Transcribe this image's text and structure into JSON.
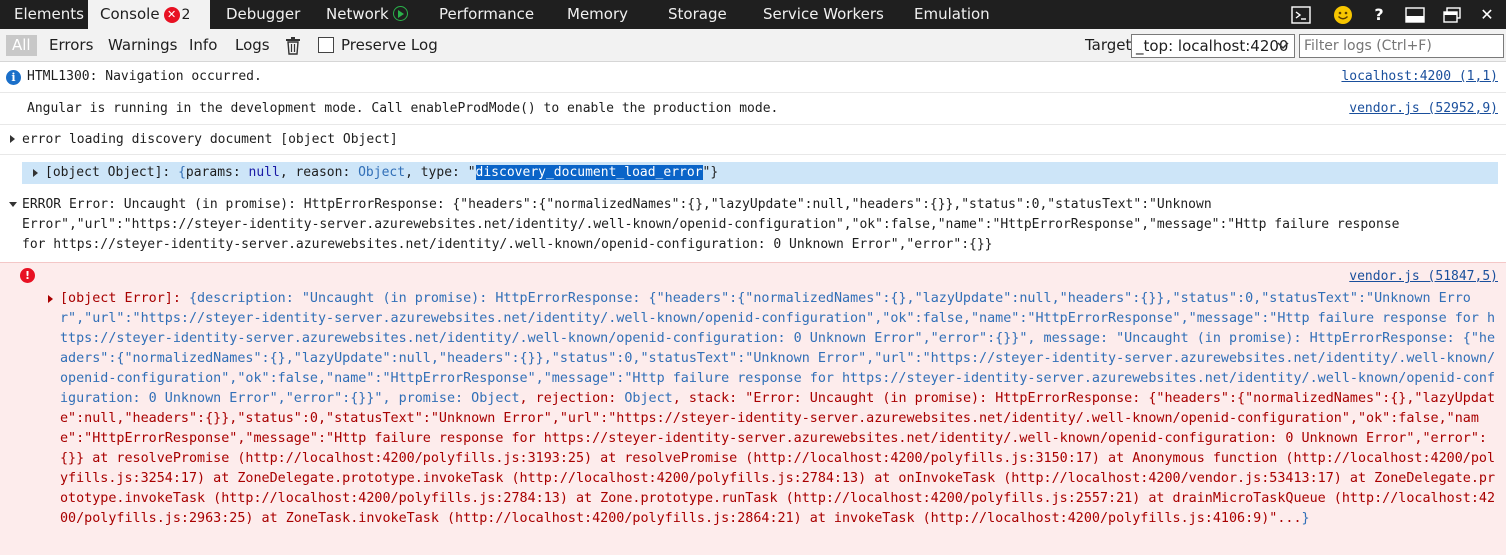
{
  "tabs": {
    "elements": "Elements",
    "console": "Console",
    "console_error_count": "2",
    "debugger": "Debugger",
    "network": "Network",
    "performance": "Performance",
    "memory": "Memory",
    "storage": "Storage",
    "service_workers": "Service Workers",
    "emulation": "Emulation"
  },
  "toolbar": {
    "all": "All",
    "errors": "Errors",
    "warnings": "Warnings",
    "info": "Info",
    "logs": "Logs",
    "preserve_log": "Preserve Log",
    "target_label": "Target",
    "target_value": "_top: localhost:4200",
    "filter_placeholder": "Filter logs (Ctrl+F)"
  },
  "console": {
    "line1": {
      "text": "HTML1300: Navigation occurred.",
      "source": "localhost:4200 (1,1)"
    },
    "line2": {
      "text": "Angular is running in the development mode. Call enableProdMode() to enable the production mode.",
      "source": "vendor.js (52952,9)"
    },
    "line3": {
      "text": "error loading discovery document [object Object]"
    },
    "line4": {
      "p1": "[object Object]: ",
      "p2": "{",
      "p3": "params: ",
      "p4": "null",
      "p5": ", reason: ",
      "p6": "Object",
      "p7": ", type: \"",
      "p8": "discovery_document_load_error",
      "p9": "\"}"
    },
    "line5": {
      "row1": "ERROR Error: Uncaught (in promise): HttpErrorResponse: {\"headers\":{\"normalizedNames\":{},\"lazyUpdate\":null,\"headers\":{}},\"status\":0,\"statusText\":\"Unknown",
      "row2": "Error\",\"url\":\"https://steyer-identity-server.azurewebsites.net/identity/.well-known/openid-configuration\",\"ok\":false,\"name\":\"HttpErrorResponse\",\"message\":\"Http failure response",
      "row3": "for https://steyer-identity-server.azurewebsites.net/identity/.well-known/openid-configuration: 0 Unknown Error\",\"error\":{}}"
    },
    "error_block": {
      "source": "vendor.js (51847,5)",
      "head": "[object Error]: ",
      "t1": "{description: \"Uncaught (in promise): HttpErrorResponse: {\"headers\":{\"normalizedNames\":{},\"lazyUpdate\":null,\"headers\":{}},\"status\":0,\"statusText\":\"Unknown Error\",\"url\":\"https://steyer-identity-server.azurewebsites.net/identity/.well-known/openid-configuration\",\"ok\":false,\"name\":\"HttpErrorResponse\",\"message\":\"Http failure response for https://steyer-identity-server.azurewebsites.net/identity/.well-known/openid-configuration: 0 Unknown Error\",\"error\":{}}\", message: \"Uncaught (in promise): HttpErrorResponse: {\"headers\":{\"normalizedNames\":{},\"lazyUpdate\":null,\"headers\":{}},\"status\":0,\"statusText\":\"Unknown Error\",\"url\":\"https://steyer-identity-server.azurewebsites.net/identity/.well-known/openid-configuration\",\"ok\":false,\"name\":\"HttpErrorResponse\",\"message\":\"Http failure response for https://steyer-identity-server.azurewebsites.net/identity/.well-known/openid-configuration: 0 Unknown Error\",\"error\":{}}\", promise: ",
      "o1": "Object",
      "t2": ", rejection: ",
      "o2": "Object",
      "t3": ", stack: \"Error: Uncaught (in promise): HttpErrorResponse: {\"headers\":{\"normalizedNames\":{},\"lazyUpdate\":null,\"headers\":{}},\"status\":0,\"statusText\":\"Unknown Error\",\"url\":\"https://steyer-identity-server.azurewebsites.net/identity/.well-known/openid-configuration\",\"ok\":false,\"name\":\"HttpErrorResponse\",\"message\":\"Http failure response for https://steyer-identity-server.azurewebsites.net/identity/.well-known/openid-configuration: 0 Unknown Error\",\"error\":{}} at resolvePromise (http://localhost:4200/polyfills.js:3193:25) at resolvePromise (http://localhost:4200/polyfills.js:3150:17) at Anonymous function (http://localhost:4200/polyfills.js:3254:17) at ZoneDelegate.prototype.invokeTask (http://localhost:4200/polyfills.js:2784:13) at onInvokeTask (http://localhost:4200/vendor.js:53413:17) at ZoneDelegate.prototype.invokeTask (http://localhost:4200/polyfills.js:2784:13) at Zone.prototype.runTask (http://localhost:4200/polyfills.js:2557:21) at drainMicroTaskQueue (http://localhost:4200/polyfills.js:2963:25) at ZoneTask.invokeTask (http://localhost:4200/polyfills.js:2864:21) at invokeTask (http://localhost:4200/polyfills.js:4106:9)\"...",
      "close": "}"
    }
  },
  "colors": {
    "accent": "#0a64c8",
    "error_bg": "#fdecec",
    "error_text": "#a80000",
    "link": "#1a4f9c"
  }
}
